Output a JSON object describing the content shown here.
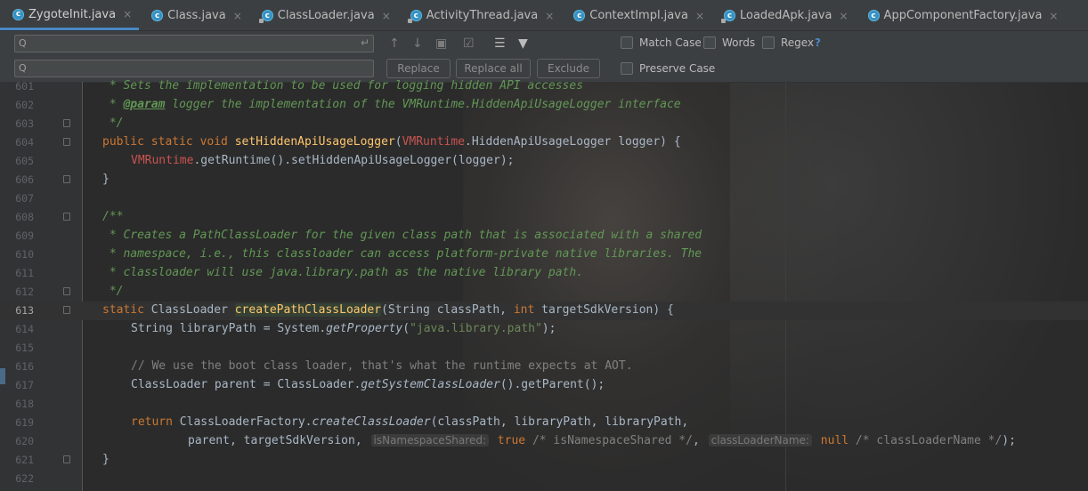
{
  "tabs": [
    {
      "label": "ZygoteInit.java",
      "active": true
    },
    {
      "label": "Class.java"
    },
    {
      "label": "ClassLoader.java"
    },
    {
      "label": "ActivityThread.java"
    },
    {
      "label": "ContextImpl.java"
    },
    {
      "label": "LoadedApk.java"
    },
    {
      "label": "AppComponentFactory.java"
    }
  ],
  "tab_icon_letter": "c",
  "tab_close": "×",
  "find": {
    "search_value": "",
    "replace_value": "",
    "search_icon": "Q",
    "enter_icon": "↵",
    "replace_label": "Replace",
    "replace_all_label": "Replace all",
    "exclude_label": "Exclude",
    "match_case_label": "Match Case",
    "words_label": "Words",
    "regex_label": "Regex",
    "help_label": "?",
    "preserve_case_label": "Preserve Case"
  },
  "toolbar_icons": [
    "↑",
    "↓",
    "▣",
    "☑",
    "☰",
    "▼"
  ],
  "colors": {
    "accent": "#4a88c7",
    "keyword": "#cc7832",
    "doc": "#629755",
    "function": "#ffc66d",
    "string": "#6a8759",
    "comment": "#808080"
  },
  "lines": [
    {
      "n": "601",
      "fold": false
    },
    {
      "n": "602",
      "fold": false
    },
    {
      "n": "603",
      "fold": true
    },
    {
      "n": "604",
      "fold": true
    },
    {
      "n": "605",
      "fold": false
    },
    {
      "n": "606",
      "fold": true
    },
    {
      "n": "607",
      "fold": false
    },
    {
      "n": "608",
      "fold": true
    },
    {
      "n": "609",
      "fold": false
    },
    {
      "n": "610",
      "fold": false
    },
    {
      "n": "611",
      "fold": false
    },
    {
      "n": "612",
      "fold": true
    },
    {
      "n": "613",
      "fold": true,
      "current": true
    },
    {
      "n": "614",
      "fold": false
    },
    {
      "n": "615",
      "fold": false
    },
    {
      "n": "616",
      "fold": false
    },
    {
      "n": "617",
      "fold": false
    },
    {
      "n": "618",
      "fold": false
    },
    {
      "n": "619",
      "fold": false
    },
    {
      "n": "620",
      "fold": false
    },
    {
      "n": "621",
      "fold": true
    },
    {
      "n": "622",
      "fold": false
    }
  ],
  "code": {
    "l601": " * Sets the implementation to be used for logging hidden API accesses",
    "l602_star": " * ",
    "l602_tag": "@param",
    "l602_rest": " logger the implementation of the VMRuntime.HiddenApiUsageLogger interface",
    "l603": " */",
    "l604_kw": "public static void ",
    "l604_fn": "setHiddenApiUsageLogger",
    "l604_p1": "(",
    "l604_red": "VMRuntime",
    "l604_rest": ".HiddenApiUsageLogger logger) {",
    "l605_red": "VMRuntime",
    "l605_rest": ".getRuntime().setHiddenApiUsageLogger(logger);",
    "l606": "}",
    "l608": "/**",
    "l609": " * Creates a PathClassLoader for the given class path that is associated with a shared",
    "l610": " * namespace, i.e., this classloader can access platform-private native libraries. The",
    "l611": " * classloader will use java.library.path as the native library path.",
    "l612": " */",
    "l613_kw": "static ",
    "l613_type": "ClassLoader ",
    "l613_fn": "createPathClassLoader",
    "l613_p1": "(String classPath, ",
    "l613_kw2": "int ",
    "l613_rest": "targetSdkVersion) {",
    "l614_a": "String libraryPath = System.",
    "l614_it": "getProperty",
    "l614_p": "(",
    "l614_str": "\"java.library.path\"",
    "l614_end": ");",
    "l616": "// We use the boot class loader, that's what the runtime expects at AOT.",
    "l617_a": "ClassLoader parent = ClassLoader.",
    "l617_it": "getSystemClassLoader",
    "l617_end": "().getParent();",
    "l619_kw": "return ",
    "l619_a": "ClassLoaderFactory.",
    "l619_it": "createClassLoader",
    "l619_end": "(classPath, libraryPath, libraryPath,",
    "l620_a": "parent, targetSdkVersion, ",
    "l620_hint1": "isNamespaceShared:",
    "l620_kw1": " true",
    "l620_c1": " /* isNamespaceShared */",
    "l620_sep": ", ",
    "l620_hint2": "classLoaderName:",
    "l620_kw2": " null",
    "l620_c2": " /* classLoaderName */",
    "l620_end": ");",
    "l621": "}"
  }
}
